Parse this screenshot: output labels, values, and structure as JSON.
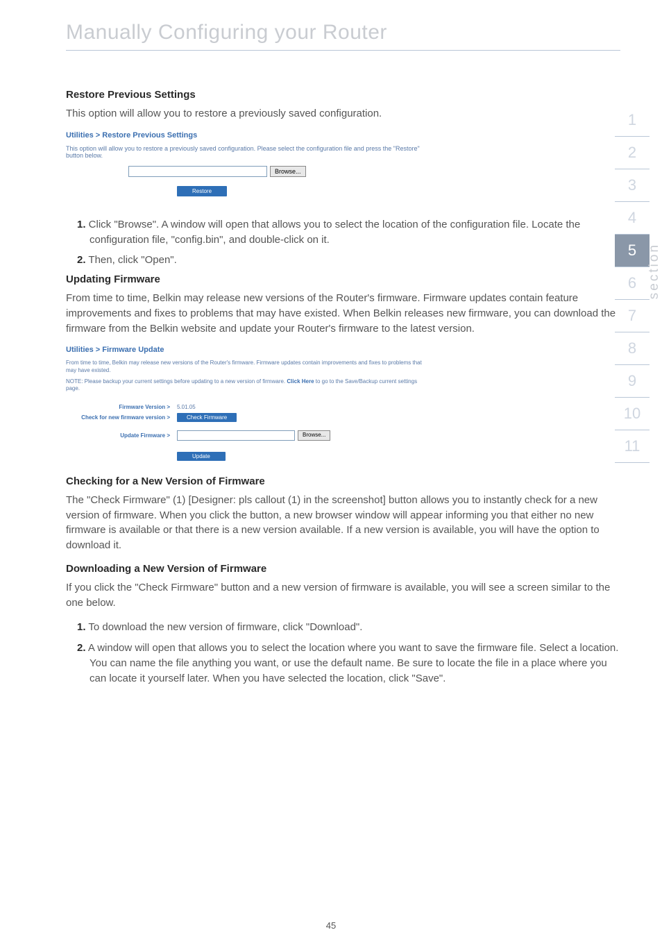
{
  "chapter_title": "Manually Configuring your Router",
  "restore": {
    "heading": "Restore Previous Settings",
    "intro": "This option will allow you to restore a previously saved configuration.",
    "mock_title": "Utilities > Restore Previous Settings",
    "mock_desc": "This option will allow you to restore a previously saved configuration. Please select the configuration file and press the \"Restore\" button below.",
    "browse_label": "Browse...",
    "restore_btn": "Restore",
    "step1_num": "1.",
    "step1": " Click \"Browse\". A window will open that allows you to select the location of the configuration file. Locate the configuration file, \"config.bin\", and double-click on it.",
    "step2_num": "2.",
    "step2": " Then, click \"Open\"."
  },
  "firmware": {
    "heading": "Updating Firmware",
    "intro": "From time to time, Belkin may release new versions of the Router's firmware. Firmware updates contain feature improvements and fixes to problems that may have existed. When Belkin releases new firmware, you can download the firmware from the Belkin website and update your Router's firmware to the latest version.",
    "mock_title": "Utilities > Firmware Update",
    "mock_desc1": "From time to time, Belkin may release new versions of the Router's firmware. Firmware updates contain improvements and fixes to problems that may have existed.",
    "mock_desc2a": "NOTE: Please backup your current settings before updating to a new version of firmware. ",
    "mock_desc2_link": "Click Here",
    "mock_desc2b": " to go to the Save/Backup current settings page.",
    "fw_version_label": "Firmware Version >",
    "fw_version_value": "5.01.05",
    "check_label": "Check for new firmware version >",
    "check_btn": "Check Firmware",
    "update_label": "Update Firmware >",
    "browse_label": "Browse...",
    "update_btn": "Update"
  },
  "checking": {
    "heading": "Checking for a New Version of Firmware",
    "text": "The \"Check Firmware\" (1) [Designer: pls callout (1) in the screenshot] button allows you to instantly check for a new version of firmware. When you click the button, a new browser window will appear informing you that either no new firmware is available or that there is a new version available. If a new version is available, you will have the option to download it."
  },
  "downloading": {
    "heading": "Downloading a New Version of Firmware",
    "intro": "If you click the \"Check Firmware\" button and a new version of firmware is available, you will see a screen similar to the one below.",
    "step1_num": "1.",
    "step1": " To download the new version of firmware, click \"Download\".",
    "step2_num": "2.",
    "step2": " A window will open that allows you to select the location where you want to save the firmware file. Select a location. You can name the file anything you want, or use the default name. Be sure to locate the file in a place where you can locate it yourself later. When you have selected the location, click \"Save\"."
  },
  "side_nav": [
    "1",
    "2",
    "3",
    "4",
    "5",
    "6",
    "7",
    "8",
    "9",
    "10",
    "11"
  ],
  "side_nav_active_index": 4,
  "section_label": "section",
  "page_number": "45"
}
